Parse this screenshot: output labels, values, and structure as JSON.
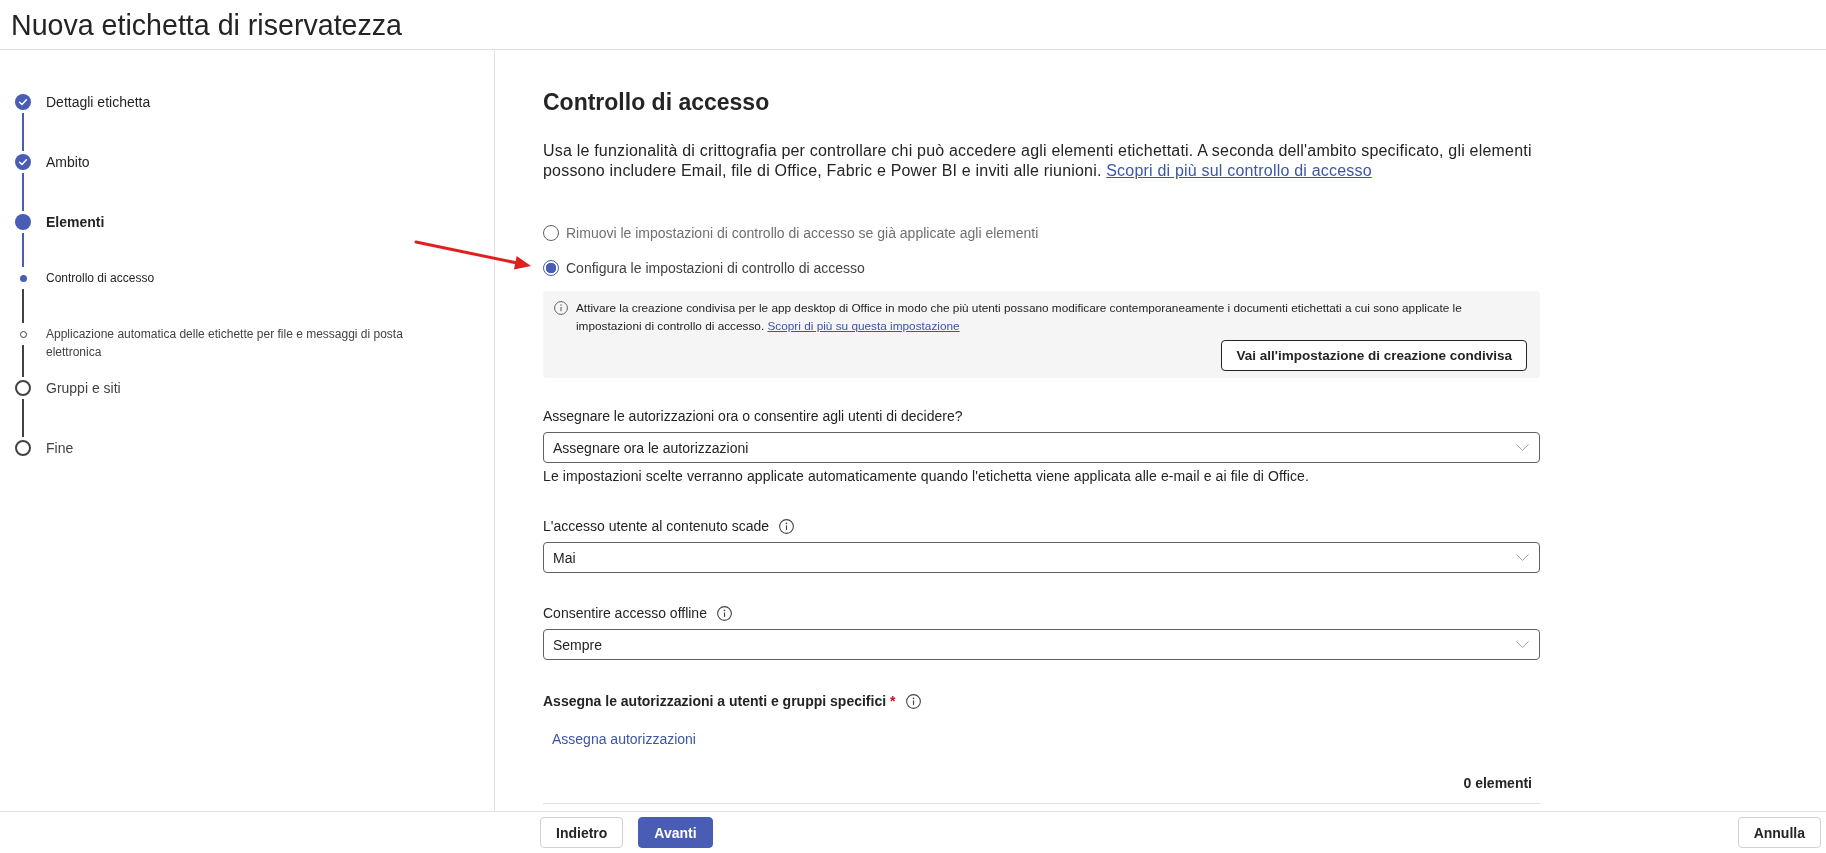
{
  "header": {
    "title": "Nuova etichetta di riservatezza"
  },
  "steps": [
    {
      "label": "Dettagli etichetta",
      "kind": "step",
      "completed": true,
      "current": false
    },
    {
      "label": "Ambito",
      "kind": "step",
      "completed": true,
      "current": false
    },
    {
      "label": "Elementi",
      "kind": "step",
      "completed": false,
      "current": true
    },
    {
      "label": "Controllo di accesso",
      "kind": "substep",
      "completed": false,
      "current": true
    },
    {
      "label": "Applicazione automatica delle etichette per file e messaggi di posta elettronica",
      "kind": "substep",
      "completed": false,
      "current": false
    },
    {
      "label": "Gruppi e siti",
      "kind": "step",
      "completed": false,
      "current": false
    },
    {
      "label": "Fine",
      "kind": "step",
      "completed": false,
      "current": false
    }
  ],
  "main": {
    "heading": "Controllo di accesso",
    "description": "Usa le funzionalità di crittografia per controllare chi può accedere agli elementi etichettati. A seconda dell'ambito specificato, gli elementi possono includere Email, file di Office, Fabric e Power BI e inviti alle riunioni.",
    "description_link": "Scopri di più sul controllo di accesso",
    "options": [
      {
        "label": "Rimuovi le impostazioni di controllo di accesso se già applicate agli elementi",
        "selected": false
      },
      {
        "label": "Configura le impostazioni di controllo di accesso",
        "selected": true
      }
    ],
    "info_box": {
      "text": "Attivare la creazione condivisa per le app desktop di Office in modo che più utenti possano modificare contemporaneamente i documenti etichettati a cui sono applicate le impostazioni di controllo di accesso.",
      "link": "Scopri di più su questa impostazione",
      "button": "Vai all'impostazione di creazione condivisa"
    },
    "fields": [
      {
        "label": "Assegnare le autorizzazioni ora o consentire agli utenti di decidere?",
        "info": false,
        "value": "Assegnare ora le autorizzazioni",
        "helper": "Le impostazioni scelte verranno applicate automaticamente quando l'etichetta viene applicata alle e-mail e ai file di Office."
      },
      {
        "label": "L'accesso utente al contenuto scade",
        "info": true,
        "value": "Mai"
      },
      {
        "label": "Consentire accesso offline",
        "info": true,
        "value": "Sempre"
      }
    ],
    "assign": {
      "label": "Assegna le autorizzazioni a utenti e gruppi specifici",
      "required_mark": "*",
      "info": true,
      "link": "Assegna autorizzazioni",
      "count": "0 elementi"
    }
  },
  "footer": {
    "buttons": [
      {
        "label": "Indietro",
        "kind": "secondary"
      },
      {
        "label": "Avanti",
        "kind": "primary"
      }
    ],
    "cancel": "Annulla"
  }
}
